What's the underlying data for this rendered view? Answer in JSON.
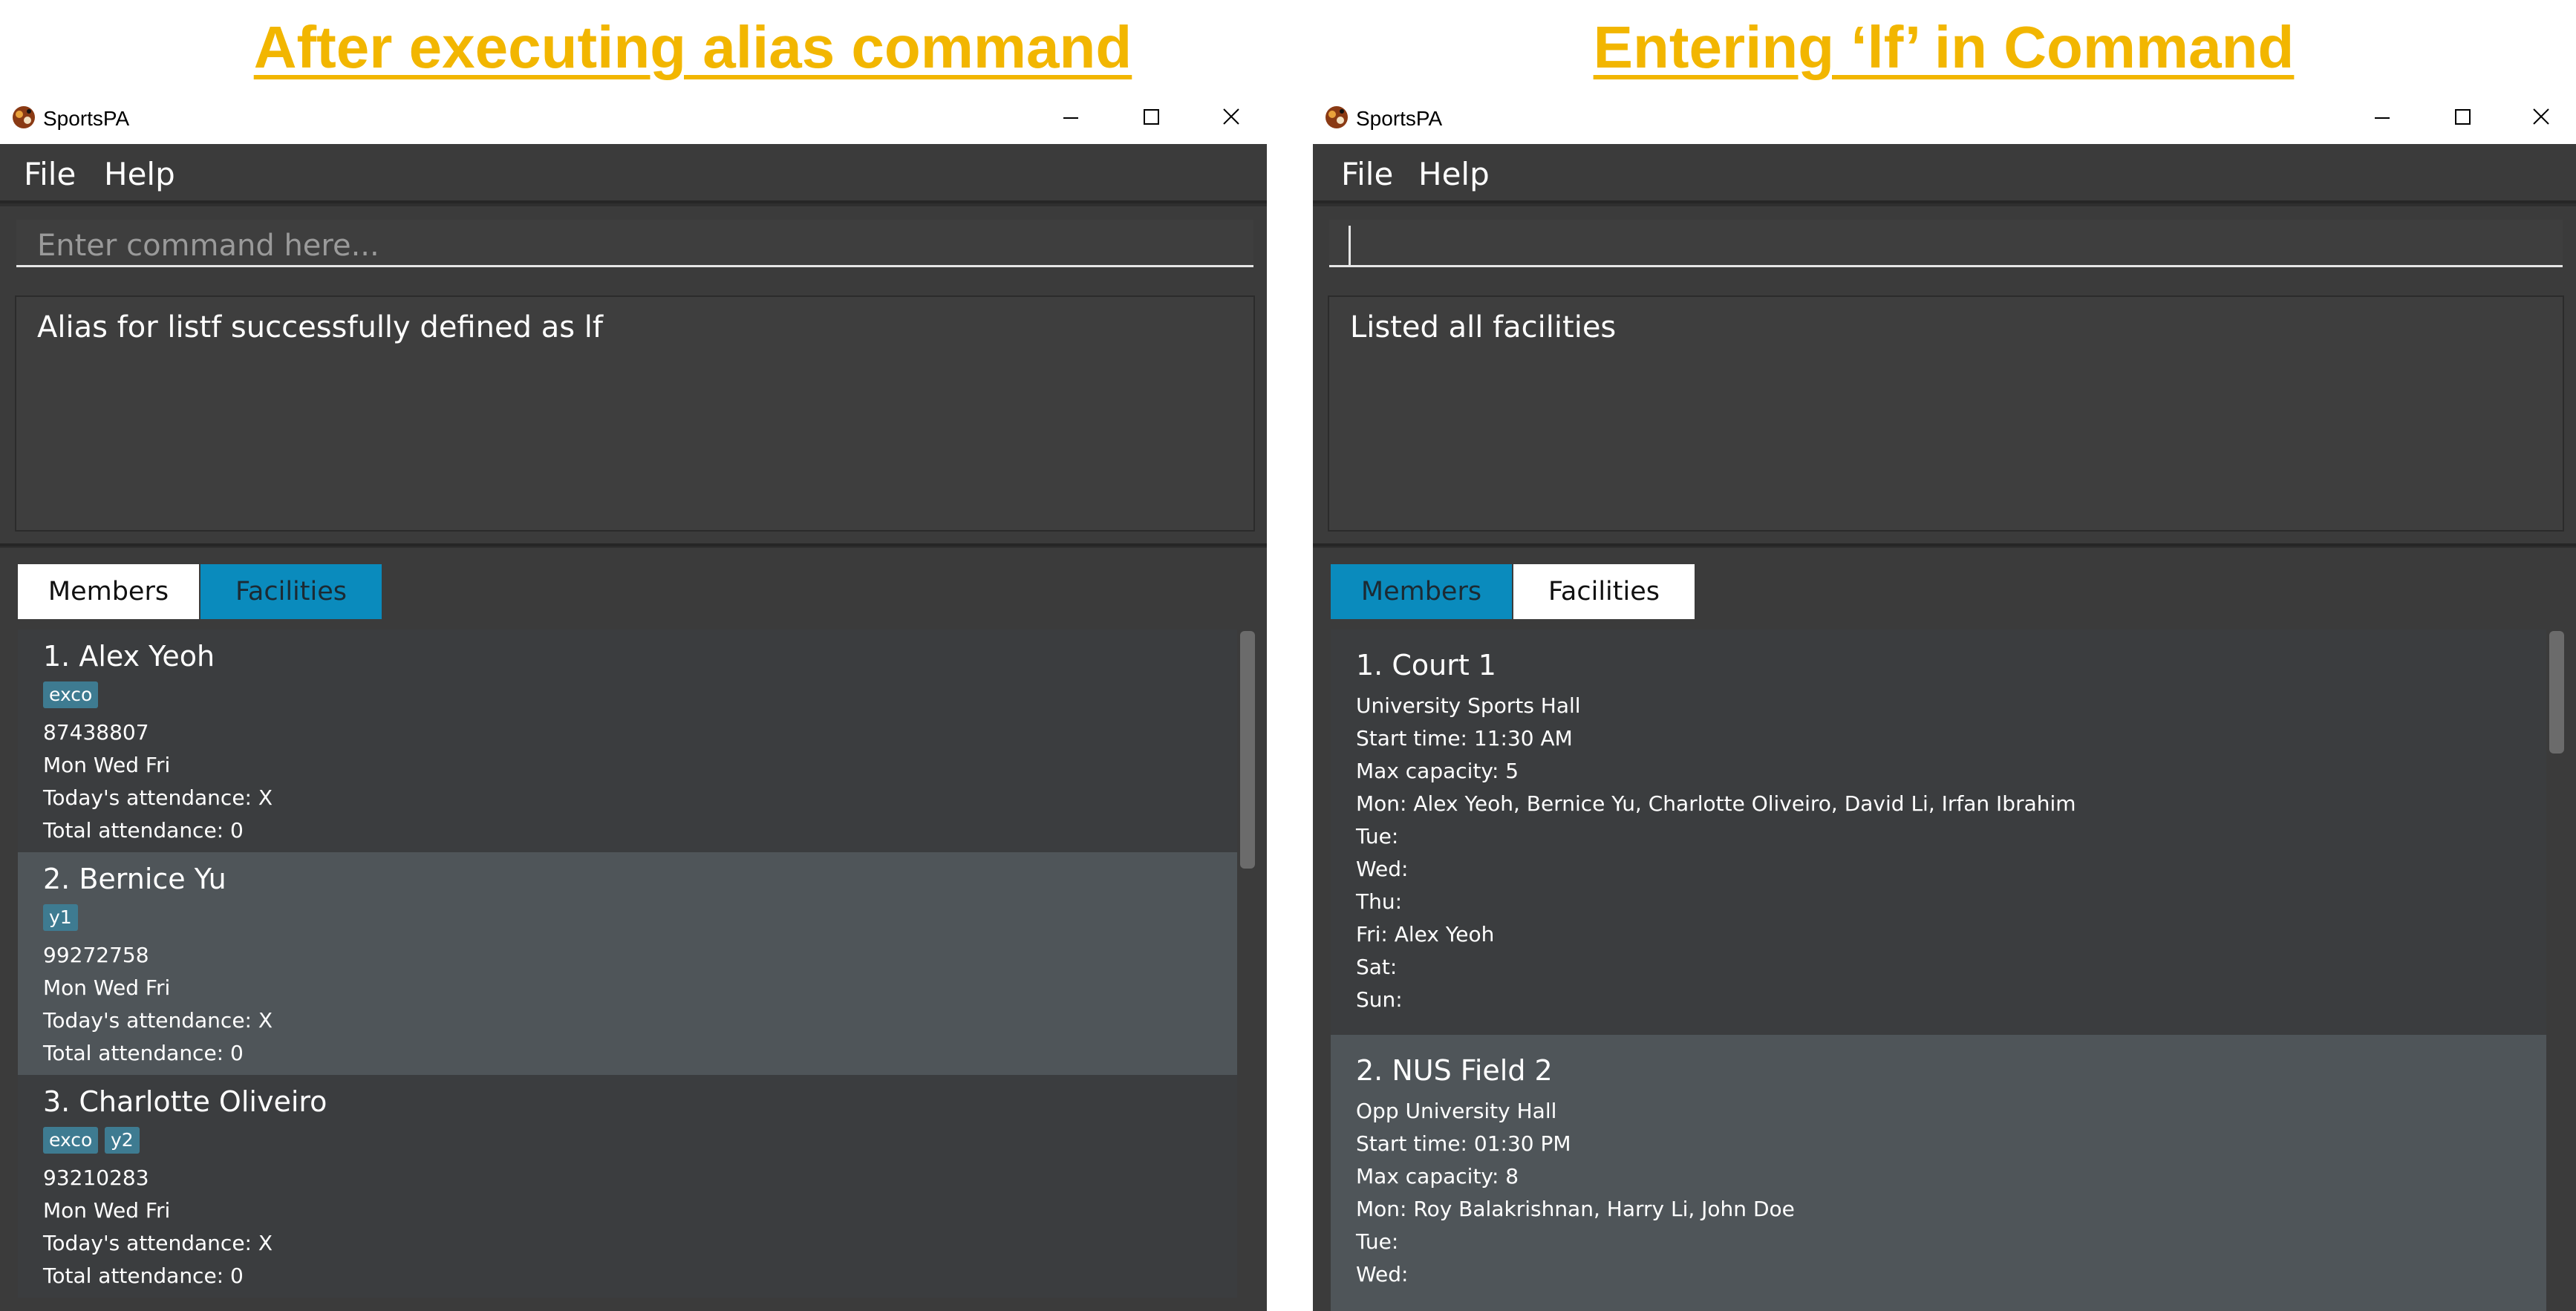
{
  "captions": {
    "left": "After executing alias command",
    "right": "Entering ‘lf’ in Command"
  },
  "colors": {
    "caption": "#f2b600",
    "accent_tab": "#0a8bbd",
    "tag": "#3e7b91",
    "app_bg": "#3b3b3b"
  },
  "left_window": {
    "app_title": "SportsPA",
    "menu": {
      "file": "File",
      "help": "Help"
    },
    "command": {
      "value": "",
      "placeholder": "Enter command here..."
    },
    "result": "Alias for listf successfully defined as lf",
    "tabs": {
      "members": "Members",
      "facilities": "Facilities",
      "selected": "Members"
    },
    "members": [
      {
        "title": "1.  Alex Yeoh",
        "tags": [
          "exco"
        ],
        "phone": "87438807",
        "days": "Mon Wed Fri",
        "today": "Today's attendance: X",
        "total": "Total attendance: 0"
      },
      {
        "title": "2.  Bernice Yu",
        "tags": [
          "y1"
        ],
        "phone": "99272758",
        "days": "Mon Wed Fri",
        "today": "Today's attendance: X",
        "total": "Total attendance: 0"
      },
      {
        "title": "3.  Charlotte Oliveiro",
        "tags": [
          "exco",
          "y2"
        ],
        "phone": "93210283",
        "days": "Mon Wed Fri",
        "today": "Today's attendance: X",
        "total": "Total attendance: 0"
      }
    ]
  },
  "right_window": {
    "app_title": "SportsPA",
    "menu": {
      "file": "File",
      "help": "Help"
    },
    "command": {
      "value": "",
      "placeholder": ""
    },
    "result": "Listed all facilities",
    "tabs": {
      "members": "Members",
      "facilities": "Facilities",
      "selected": "Facilities"
    },
    "facilities": [
      {
        "title": "1. Court 1",
        "lines": [
          "University Sports Hall",
          "Start time: 11:30 AM",
          "Max capacity: 5",
          "Mon: Alex Yeoh, Bernice Yu, Charlotte Oliveiro, David Li, Irfan Ibrahim",
          "Tue:",
          "Wed:",
          "Thu:",
          "Fri: Alex Yeoh",
          "Sat:",
          "Sun:"
        ]
      },
      {
        "title": "2. NUS Field 2",
        "lines": [
          "Opp University Hall",
          "Start time: 01:30 PM",
          "Max capacity: 8",
          "Mon: Roy Balakrishnan, Harry Li, John Doe",
          "Tue:",
          "Wed:"
        ]
      }
    ]
  }
}
